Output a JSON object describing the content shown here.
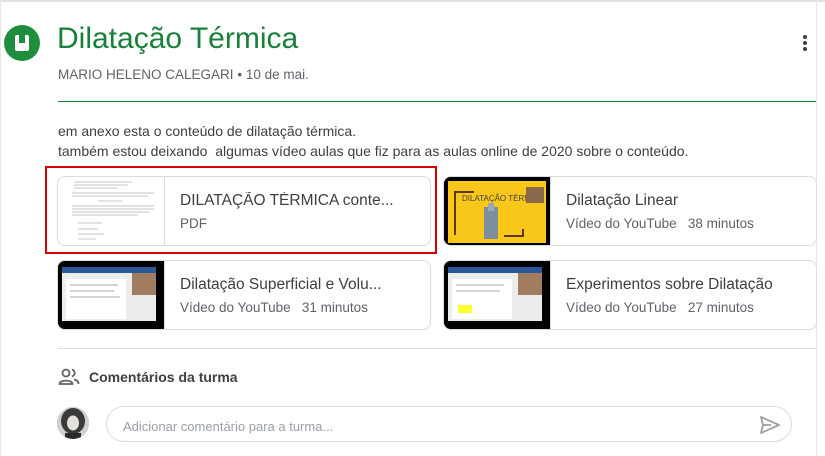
{
  "post": {
    "title": "Dilatação Térmica",
    "author": "MARIO HELENO CALEGARI",
    "separator": "•",
    "date": "10 de mai.",
    "description_line1": "em anexo esta o conteúdo de dilatação térmica.",
    "description_line2": "também estou deixando  algumas vídeo aulas que fiz para as aulas online de 2020 sobre o conteúdo."
  },
  "attachments": [
    {
      "title": "DILATAÇÃO TÉRMICA conte...",
      "subtitle": "PDF",
      "duration": "",
      "icon": "pdf-thumbnail"
    },
    {
      "title": "Dilatação Linear",
      "subtitle": "Vídeo do YouTube",
      "duration": "38 minutos",
      "icon": "video-thumbnail",
      "thumb_text": "DILATAÇÃO TÉRMICA"
    },
    {
      "title": "Dilatação Superficial e Volu...",
      "subtitle": "Vídeo do YouTube",
      "duration": "31 minutos",
      "icon": "video-thumbnail"
    },
    {
      "title": "Experimentos sobre Dilatação",
      "subtitle": "Vídeo do YouTube",
      "duration": "27 minutos",
      "icon": "video-thumbnail"
    }
  ],
  "comments": {
    "label": "Comentários da turma",
    "placeholder": "Adicionar comentário para a turma..."
  },
  "colors": {
    "accent": "#188038",
    "icon_bg": "#1e8e3e",
    "highlight": "#d50000",
    "thumb_yellow": "#f9c61a"
  }
}
